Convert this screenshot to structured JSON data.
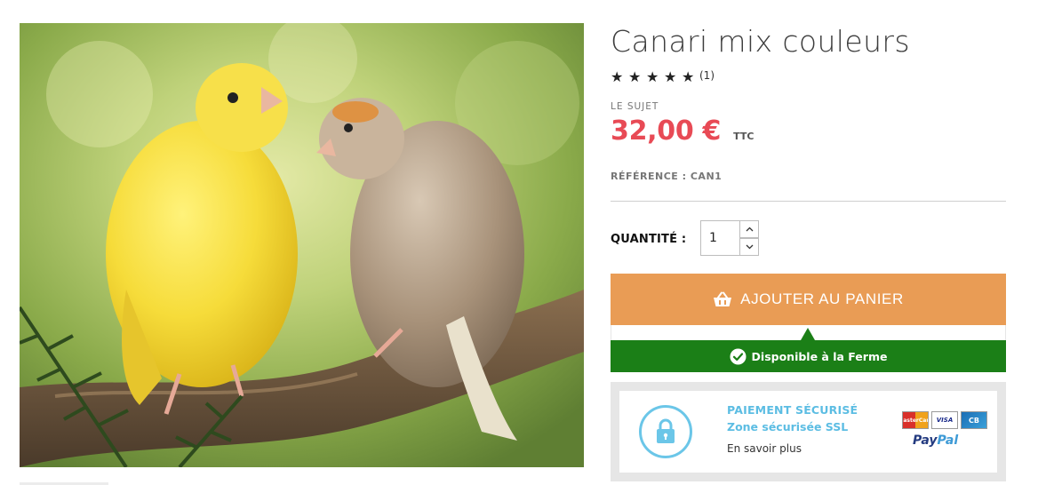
{
  "product": {
    "title": "Canari mix couleurs",
    "rating": {
      "stars_filled": 5,
      "stars_total": 5,
      "count_label": "(1)"
    },
    "unit_label": "LE SUJET",
    "price": "32,00 €",
    "tax_label": "TTC",
    "reference_label": "RÉFÉRENCE : ",
    "reference_value": "CAN1",
    "quantity_label": "QUANTITÉ :",
    "quantity_value": "1"
  },
  "cart": {
    "add_button_label": "AJOUTER AU PANIER",
    "button_color": "#e99c55",
    "icon": "basket-icon"
  },
  "availability": {
    "label": "Disponible à la Ferme",
    "color": "#1b7f17",
    "icon": "check-circle-icon"
  },
  "secure_payment": {
    "title": "PAIEMENT SÉCURISÉ",
    "subtitle": "Zone sécurisée SSL",
    "link_label": "En savoir plus",
    "accent_color": "#5cbde3",
    "icon": "lock-icon",
    "cards": {
      "mastercard_label": "MasterCard",
      "visa_label": "VISA",
      "cb_label": "CB"
    },
    "paypal": {
      "part1": "Pay",
      "part2": "Pal"
    }
  },
  "colors": {
    "price": "#e84a55",
    "title": "#3d3d3d"
  }
}
